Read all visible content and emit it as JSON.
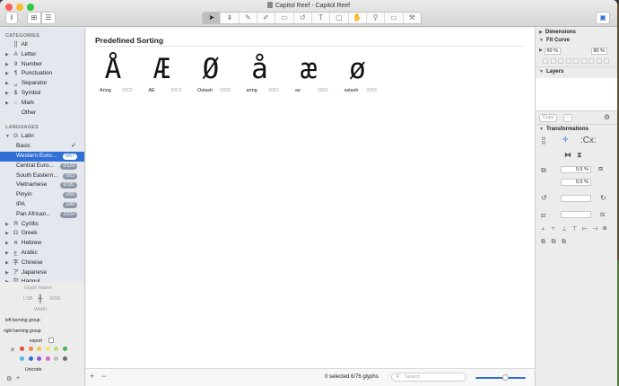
{
  "window": {
    "url_fragment": "https://forum.glyphsapp.com",
    "title": "Capitol Reef - Capitol Reef",
    "colors": {
      "close": "#fc5f57",
      "minimize": "#fdbc2e",
      "zoom": "#28c840",
      "accent": "#2f6fd6"
    }
  },
  "toolbar": {
    "info_icon": "i",
    "grid_icon": "⊞",
    "list_icon": "☰",
    "tools": [
      "➤",
      "⇟",
      "✎",
      "✐",
      "▭",
      "↺",
      "T",
      "▢",
      "✋",
      "⚲",
      "▭",
      "⚒"
    ],
    "panel_toggle_icon": "▣"
  },
  "sidebar": {
    "categories_header": "CATEGORIES",
    "categories": [
      {
        "label": "All",
        "icon": "⣿",
        "arrow": ""
      },
      {
        "label": "Letter",
        "icon": "A",
        "arrow": "▶"
      },
      {
        "label": "Number",
        "icon": "9",
        "arrow": "▶"
      },
      {
        "label": "Punctuation",
        "icon": "¶",
        "arrow": "▶"
      },
      {
        "label": "Separator",
        "icon": "␣",
        "arrow": "▶"
      },
      {
        "label": "Symbol",
        "icon": "$",
        "arrow": "▶"
      },
      {
        "label": "Mark",
        "icon": "◌",
        "arrow": "▶"
      },
      {
        "label": "Other",
        "icon": "",
        "arrow": ""
      }
    ],
    "languages_header": "LANGUAGES",
    "latin": {
      "label": "Latin",
      "icon": "G",
      "arrow": "▼"
    },
    "latin_items": [
      {
        "label": "Basic",
        "badge": "",
        "check": "✓",
        "selected": false
      },
      {
        "label": "Western Euro...",
        "badge": "6/67",
        "check": "",
        "selected": true
      },
      {
        "label": "Central Euro...",
        "badge": "0/129",
        "check": "",
        "selected": false
      },
      {
        "label": "South Eastern...",
        "badge": "0/53",
        "check": "",
        "selected": false
      },
      {
        "label": "Vietnamese",
        "badge": "0/181",
        "check": "",
        "selected": false
      },
      {
        "label": "Pinyin",
        "badge": "0/58",
        "check": "",
        "selected": false
      },
      {
        "label": "IPA",
        "badge": "2/88",
        "check": "",
        "selected": false
      },
      {
        "label": "Pan African...",
        "badge": "2/224",
        "check": "",
        "selected": false
      }
    ],
    "other_languages": [
      {
        "label": "Cyrillic",
        "icon": "Я"
      },
      {
        "label": "Greek",
        "icon": "Ω"
      },
      {
        "label": "Hebrew",
        "icon": "א"
      },
      {
        "label": "Arabic",
        "icon": "ع"
      },
      {
        "label": "Chinese",
        "icon": "字"
      },
      {
        "label": "Japanese",
        "icon": "ア"
      },
      {
        "label": "Hangul",
        "icon": "한"
      }
    ]
  },
  "glyph_panel": {
    "glyph_name_placeholder": "Glyph Name",
    "lsb": "LSB",
    "rsb": "RSB",
    "width": "Width",
    "left_kerning": "left kerning group",
    "right_kerning": "right kerning group",
    "export": "export",
    "unicode": "Unicode",
    "swatches": [
      "#e24c3c",
      "#f08a3e",
      "#f2c94c",
      "#f5e86a",
      "#b5e26e",
      "#48b35a",
      "#53b7e8",
      "#3a6fd8",
      "#8a5cd6",
      "#d96ad4",
      "#bdbdbd",
      "#6e6e6e"
    ],
    "no_color_icon": "✕",
    "gear_icon": "⚙"
  },
  "main": {
    "heading": "Predefined Sorting",
    "glyphs": [
      {
        "char": "Å",
        "name": "Aring",
        "code": "00C5"
      },
      {
        "char": "Æ",
        "name": "AE",
        "code": "00C6"
      },
      {
        "char": "Ø",
        "name": "Oslash",
        "code": "00D8"
      },
      {
        "char": "å",
        "name": "aring",
        "code": "00E5"
      },
      {
        "char": "æ",
        "name": "ae",
        "code": "00E6"
      },
      {
        "char": "ø",
        "name": "oslash",
        "code": "00F8"
      }
    ],
    "add_label": "+",
    "remove_label": "−",
    "status": "0 selected 6/76 glyphs",
    "search_placeholder": "Search"
  },
  "inspector": {
    "dimensions": "Dimensions",
    "fit_curve": "Fit Curve",
    "fit_min": "60 %",
    "fit_max": "80 %",
    "layers": "Layers",
    "copy": "Copy",
    "transformations": "Transformations",
    "scale_x": "0,5 %",
    "scale_y": "0,5 %"
  }
}
